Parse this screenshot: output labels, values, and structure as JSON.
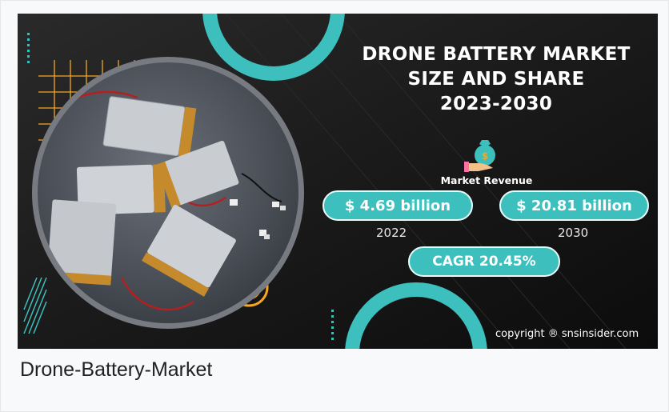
{
  "banner": {
    "title_lines": [
      "DRONE BATTERY MARKET",
      "SIZE AND SHARE",
      "2023-2030"
    ],
    "market_revenue_label": "Market Revenue",
    "value_2022": "$ 4.69 billion",
    "year_2022": "2022",
    "value_2030": "$ 20.81 billion",
    "year_2030": "2030",
    "cagr": "CAGR 20.45%",
    "copyright": "copyright ® snsinsider.com",
    "icon": "money-bag-hand-icon",
    "photo": "drone-battery-packs-photo"
  },
  "caption": "Drone-Battery-Market",
  "colors": {
    "accent_teal": "#3dbfbd",
    "accent_orange": "#f5a623",
    "background": "#111111",
    "page": "#f8f9fa"
  }
}
